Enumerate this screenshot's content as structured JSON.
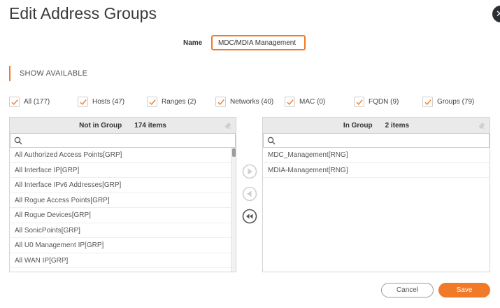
{
  "dialog": {
    "title": "Edit Address Groups",
    "close_symbol": "✕"
  },
  "name_field": {
    "label": "Name",
    "value": "MDC/MDIA Management"
  },
  "show_available": "SHOW AVAILABLE",
  "filters": [
    {
      "label": "All (177)",
      "checked": true
    },
    {
      "label": "Hosts (47)",
      "checked": true
    },
    {
      "label": "Ranges (2)",
      "checked": true
    },
    {
      "label": "Networks (40)",
      "checked": true
    },
    {
      "label": "MAC (0)",
      "checked": true
    },
    {
      "label": "FQDN (9)",
      "checked": true
    },
    {
      "label": "Groups (79)",
      "checked": true
    }
  ],
  "left_panel": {
    "title": "Not in Group",
    "count": "174 items",
    "search_placeholder": "",
    "items": [
      "All Authorized Access Points[GRP]",
      "All Interface IP[GRP]",
      "All Interface IPv6 Addresses[GRP]",
      "All Rogue Access Points[GRP]",
      "All Rogue Devices[GRP]",
      "All SonicPoints[GRP]",
      "All U0 Management IP[GRP]",
      "All WAN IP[GRP]"
    ]
  },
  "right_panel": {
    "title": "In Group",
    "count": "2 items",
    "search_placeholder": "",
    "items": [
      "MDC_Management[RNG]",
      "MDIA-Management[RNG]"
    ]
  },
  "footer": {
    "cancel_label": "Cancel",
    "save_label": "Save"
  },
  "colors": {
    "accent": "#f07a27",
    "panel_header": "#eaeaea"
  }
}
